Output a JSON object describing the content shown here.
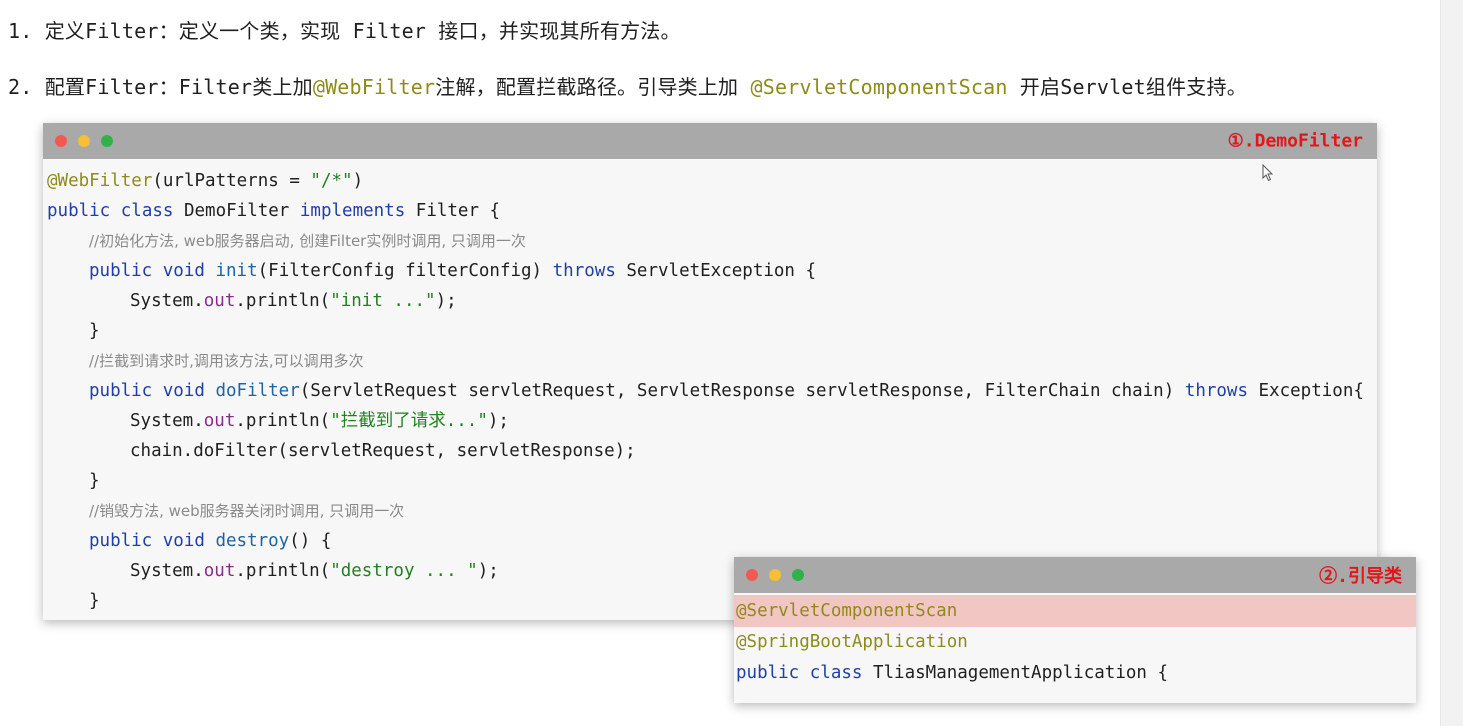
{
  "steps": [
    {
      "num": "1.",
      "parts": [
        "定义Filter：定义一个类，实现 Filter 接口，并实现其所有方法。"
      ]
    },
    {
      "num": "2.",
      "part1": "配置Filter：Filter类上加",
      "annotation1": "@WebFilter",
      "part2": "注解，配置拦截路径。引导类上加 ",
      "annotation2": "@ServletComponentScan",
      "part3": " 开启Servlet组件支持。"
    }
  ],
  "window1": {
    "label": "①.DemoFilter",
    "code": {
      "l1_ann": "@WebFilter",
      "l1_rest": "(urlPatterns = ",
      "l1_str": "\"/*\"",
      "l1_end": ")",
      "l2_kw1": "public",
      "l2_kw2": "class",
      "l2_name": " DemoFilter ",
      "l2_kw3": "implements",
      "l2_rest": " Filter {",
      "l3_cmt": "//初始化方法, web服务器启动, 创建Filter实例时调用, 只调用一次",
      "l4_kw1": "public",
      "l4_kw2": "void",
      "l4_fn": "init",
      "l4_rest": "(FilterConfig filterConfig) ",
      "l4_kw3": "throws",
      "l4_end": " ServletException {",
      "l5_pre": "System.",
      "l5_field": "out",
      "l5_mid": ".println(",
      "l5_str": "\"init ...\"",
      "l5_end": ");",
      "l6": "}",
      "l7_cmt": "//拦截到请求时,调用该方法,可以调用多次",
      "l8_kw1": "public",
      "l8_kw2": "void",
      "l8_fn": "doFilter",
      "l8_rest": "(ServletRequest servletRequest, ServletResponse servletResponse, FilterChain chain) ",
      "l8_kw3": "throws",
      "l8_end": " Exception{",
      "l9_pre": "System.",
      "l9_field": "out",
      "l9_mid": ".println(",
      "l9_str": "\"拦截到了请求...\"",
      "l9_end": ");",
      "l10": "chain.doFilter(servletRequest, servletResponse);",
      "l11": "}",
      "l12_cmt": "//销毁方法, web服务器关闭时调用, 只调用一次",
      "l13_kw1": "public",
      "l13_kw2": "void",
      "l13_fn": "destroy",
      "l13_rest": "() {",
      "l14_pre": "System.",
      "l14_field": "out",
      "l14_mid": ".println(",
      "l14_str": "\"destroy ... \"",
      "l14_end": ");",
      "l15": "}"
    }
  },
  "window2": {
    "label": "②.引导类",
    "code": {
      "l1": "@ServletComponentScan",
      "l2": "@SpringBootApplication",
      "l3_kw1": "public",
      "l3_kw2": "class",
      "l3_rest": " TliasManagementApplication {"
    }
  },
  "colors": {
    "keyword": "#1f3fa8",
    "annotation": "#8e8b1a",
    "string": "#22801f",
    "highlight_row": "#f2c6c2",
    "label_red": "#e0181b"
  }
}
